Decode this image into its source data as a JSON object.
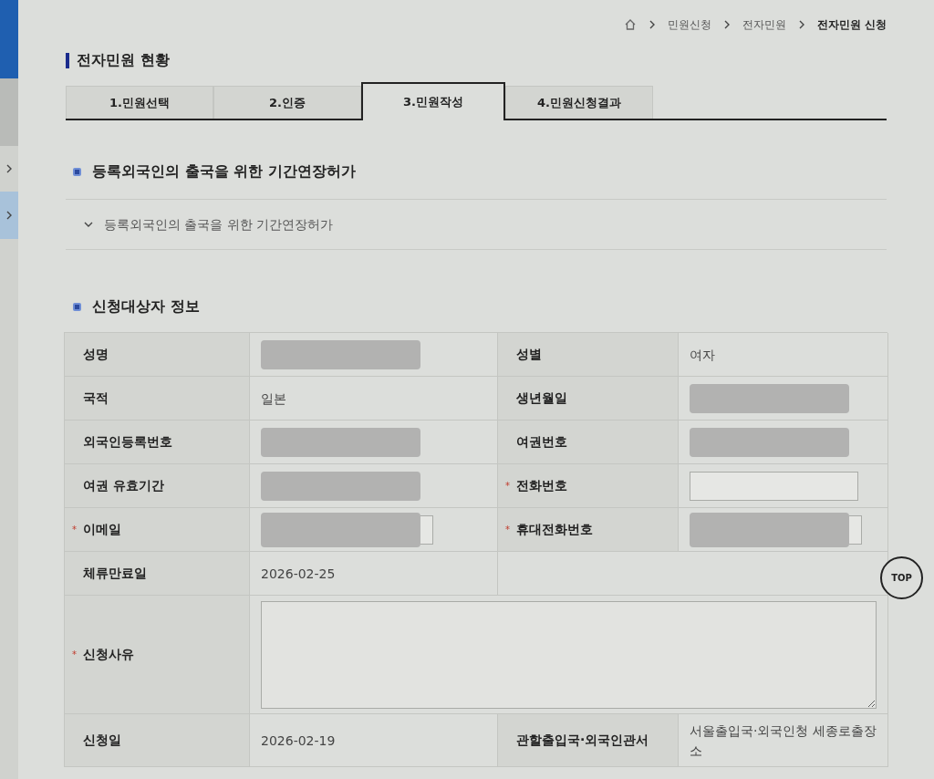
{
  "breadcrumb": [
    "민원신청",
    "전자민원",
    "전자민원 신청"
  ],
  "page_title": "전자민원 현황",
  "tabs": [
    {
      "label": "1.민원선택",
      "selected": false
    },
    {
      "label": "2.인증",
      "selected": false
    },
    {
      "label": "3.민원작성",
      "selected": true
    },
    {
      "label": "4.민원신청결과",
      "selected": false
    }
  ],
  "service": {
    "heading": "등록외국인의 출국을 위한 기간연장허가",
    "item": "등록외국인의 출국을 위한 기간연장허가",
    "expanded": true
  },
  "applicant": {
    "heading": "신청대상자 정보",
    "required_mark": "*",
    "rows": [
      [
        {
          "kind": "label",
          "text": "성명",
          "required": false
        },
        {
          "kind": "redacted"
        },
        {
          "kind": "label",
          "text": "성별",
          "required": false
        },
        {
          "kind": "text",
          "text": "여자"
        }
      ],
      [
        {
          "kind": "label",
          "text": "국적",
          "required": false
        },
        {
          "kind": "text",
          "text": "일본"
        },
        {
          "kind": "label",
          "text": "생년월일",
          "required": false
        },
        {
          "kind": "redacted"
        }
      ],
      [
        {
          "kind": "label",
          "text": "외국인등록번호",
          "required": false
        },
        {
          "kind": "redacted"
        },
        {
          "kind": "label",
          "text": "여권번호",
          "required": false
        },
        {
          "kind": "redacted"
        }
      ],
      [
        {
          "kind": "label",
          "text": "여권 유효기간",
          "required": false
        },
        {
          "kind": "redacted"
        },
        {
          "kind": "label",
          "text": "전화번호",
          "required": true
        },
        {
          "kind": "input"
        }
      ],
      [
        {
          "kind": "label",
          "text": "이메일",
          "required": true
        },
        {
          "kind": "redacted_input"
        },
        {
          "kind": "label",
          "text": "휴대전화번호",
          "required": true
        },
        {
          "kind": "redacted_input"
        }
      ],
      [
        {
          "kind": "label",
          "text": "체류만료일",
          "required": false
        },
        {
          "kind": "text",
          "text": "2026-02-25"
        },
        {
          "kind": "blank"
        }
      ],
      [
        {
          "kind": "label",
          "text": "신청사유",
          "required": true
        },
        {
          "kind": "textarea"
        }
      ],
      [
        {
          "kind": "label",
          "text": "신청일",
          "required": false
        },
        {
          "kind": "text",
          "text": "2026-02-19"
        },
        {
          "kind": "label",
          "text": "관할출입국·외국인관서",
          "required": false
        },
        {
          "kind": "text",
          "text": "서울출입국·외국인청 세종로출장소"
        }
      ]
    ]
  },
  "top_button": "TOP"
}
